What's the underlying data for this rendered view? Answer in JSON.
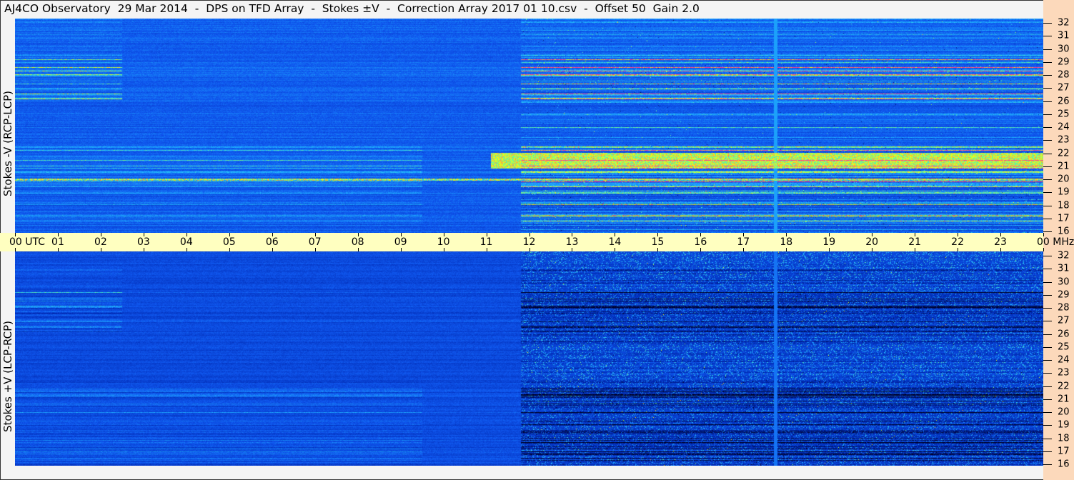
{
  "title": "AJ4CO Observatory  29 Mar 2014  -  DPS on TFD Array  -  Stokes ±V  -  Correction Array 2017 01 10.csv  -  Offset 50  Gain 2.0",
  "chart_data": {
    "type": "heatmap",
    "title": "AJ4CO Observatory 29 Mar 2014 - DPS on TFD Array - Stokes ±V",
    "xlabel": "UTC",
    "ylabel_unit": "MHz",
    "x_range": [
      0,
      24
    ],
    "y_range": [
      16,
      32
    ],
    "time_ticks": [
      "00 UTC",
      "01",
      "02",
      "03",
      "04",
      "05",
      "06",
      "07",
      "08",
      "09",
      "10",
      "11",
      "12",
      "13",
      "14",
      "15",
      "16",
      "17",
      "18",
      "19",
      "20",
      "21",
      "22",
      "23",
      "00 MHz"
    ],
    "freq_ticks": [
      "16",
      "17",
      "18",
      "19",
      "20",
      "21",
      "22",
      "23",
      "24",
      "25",
      "26",
      "27",
      "28",
      "29",
      "30",
      "31",
      "32"
    ],
    "panels": [
      {
        "name": "Stokes -V (RCP-LCP)",
        "label": "Stokes -V (RCP-LCP)"
      },
      {
        "name": "Stokes +V (LCP-RCP)",
        "label": "Stokes +V (LCP-RCP)"
      }
    ],
    "colormap": [
      "#000020",
      "#0028b0",
      "#1058f0",
      "#20b8ff",
      "#70ff90",
      "#ffff00",
      "#ff3c8c"
    ]
  },
  "colors": {
    "timebar": "#ffffc0",
    "freq_axis": "#fcd9bb",
    "background": "#f4f4f4"
  }
}
